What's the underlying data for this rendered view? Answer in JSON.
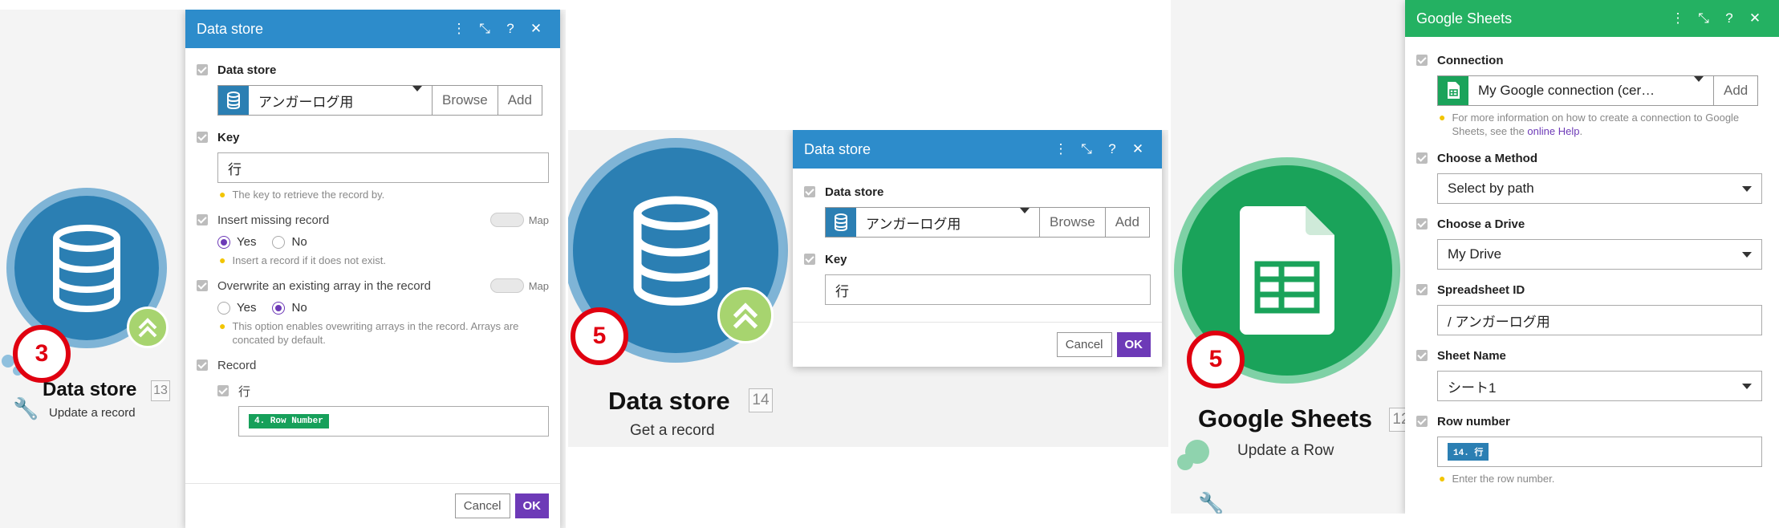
{
  "panel1": {
    "module": {
      "title": "Data store",
      "number": "13",
      "subtitle": "Update a record",
      "step": "3",
      "icon": "database-icon"
    },
    "dialog": {
      "title": "Data store",
      "header_icons": [
        "more-icon",
        "expand-icon",
        "help-icon",
        "close-icon"
      ],
      "data_store_label": "Data store",
      "data_store_value": "アンガーログ用",
      "browse": "Browse",
      "add": "Add",
      "key_label": "Key",
      "key_value": "行",
      "key_hint": "The key to retrieve the record by.",
      "insert_label": "Insert missing record",
      "map": "Map",
      "yes": "Yes",
      "no": "No",
      "insert_hint": "Insert a record if it does not exist.",
      "overwrite_label": "Overwrite an existing array in the record",
      "overwrite_hint": "This option enables ovewriting arrays in the record. Arrays are concated by default.",
      "record_label": "Record",
      "record_sub_label": "行",
      "record_pill": "4. Row Number",
      "cancel": "Cancel",
      "ok": "OK"
    }
  },
  "panel2": {
    "module": {
      "title": "Data store",
      "number": "14",
      "subtitle": "Get a record",
      "step": "5",
      "icon": "database-icon"
    },
    "dialog": {
      "title": "Data store",
      "data_store_label": "Data store",
      "data_store_value": "アンガーログ用",
      "browse": "Browse",
      "add": "Add",
      "key_label": "Key",
      "key_value": "行",
      "cancel": "Cancel",
      "ok": "OK"
    }
  },
  "panel3": {
    "module": {
      "title": "Google Sheets",
      "number": "12",
      "subtitle": "Update a Row",
      "step": "5",
      "icon": "google-sheets-icon"
    },
    "dialog": {
      "title": "Google Sheets",
      "connection_label": "Connection",
      "connection_value": "My Google connection (cer…",
      "add": "Add",
      "connection_hint_a": "For more information on how to create a connection to Google Sheets, see the ",
      "connection_hint_link": "online Help",
      "connection_hint_b": ".",
      "method_label": "Choose a Method",
      "method_value": "Select by path",
      "drive_label": "Choose a Drive",
      "drive_value": "My Drive",
      "spreadsheet_label": "Spreadsheet ID",
      "spreadsheet_value": "/ アンガーログ用",
      "sheet_label": "Sheet Name",
      "sheet_value": "シート1",
      "row_label": "Row number",
      "row_pill": "14. 行",
      "row_hint": "Enter the row number."
    }
  },
  "colors": {
    "blue_header": "#2d8ccb",
    "green_header": "#24b162",
    "ok_button": "#6d3ab7",
    "step_ring": "#e00010",
    "pill_green": "#16a05a",
    "pill_blue": "#2b7fb3"
  }
}
